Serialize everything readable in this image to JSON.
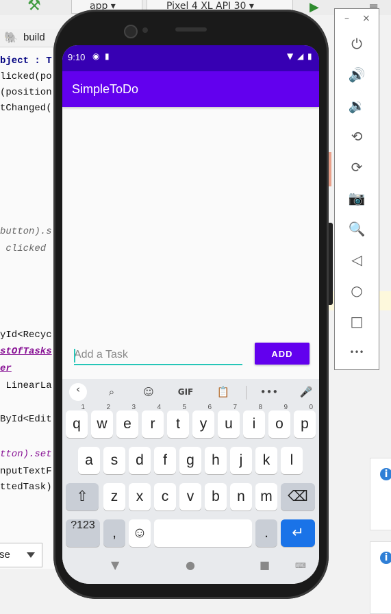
{
  "ide": {
    "config_label": "app",
    "device_label": "Pixel 4 XL API 30",
    "tab_label": "build",
    "select_label": "se",
    "code_lines": [
      {
        "text": "bject : T",
        "cls": "kw"
      },
      {
        "text": "licked(po",
        "cls": ""
      },
      {
        "text": "(position",
        "cls": ""
      },
      {
        "text": "tChanged(",
        "cls": ""
      },
      {
        "text": "button).s",
        "cls": "it"
      },
      {
        "text": " clicked ",
        "cls": "it"
      },
      {
        "text": "yId<Recyc",
        "cls": ""
      },
      {
        "text": "stOfTasks",
        "cls": "pu"
      },
      {
        "text": "er",
        "cls": "pu"
      },
      {
        "text": " LinearLa",
        "cls": ""
      },
      {
        "text": "ById<Edit",
        "cls": ""
      },
      {
        "text": "tton).set",
        "cls": "pu2"
      },
      {
        "text": "nputTextF",
        "cls": ""
      },
      {
        "text": "ttedTask)",
        "cls": ""
      }
    ]
  },
  "emulator_panel": {
    "minimize": "–",
    "close": "×",
    "buttons": [
      {
        "name": "power-icon",
        "glyph": "⏻"
      },
      {
        "name": "volume-up-icon",
        "glyph": "🔊"
      },
      {
        "name": "volume-down-icon",
        "glyph": "🔉"
      },
      {
        "name": "rotate-left-icon",
        "glyph": "⟲"
      },
      {
        "name": "rotate-right-icon",
        "glyph": "⟳"
      },
      {
        "name": "camera-icon",
        "glyph": "📷"
      },
      {
        "name": "zoom-icon",
        "glyph": "🔍"
      },
      {
        "name": "back-icon",
        "glyph": "◁"
      },
      {
        "name": "home-icon",
        "glyph": "○"
      },
      {
        "name": "overview-icon",
        "glyph": "□"
      },
      {
        "name": "more-icon",
        "glyph": "•••"
      }
    ]
  },
  "phone": {
    "status_time": "9:10",
    "app_title": "SimpleToDo",
    "input_placeholder": "Add a Task",
    "input_value": "",
    "add_button_label": "ADD",
    "colors": {
      "primary": "#6200ee",
      "primary_dark": "#3700b3",
      "accent": "#26c6b8"
    }
  },
  "keyboard": {
    "toolbar": [
      "search-icon",
      "sticker-icon",
      "GIF",
      "clipboard-icon",
      "more-icon",
      "mic-icon"
    ],
    "gif_label": "GIF",
    "row1": [
      {
        "k": "q",
        "h": "1"
      },
      {
        "k": "w",
        "h": "2"
      },
      {
        "k": "e",
        "h": "3"
      },
      {
        "k": "r",
        "h": "4"
      },
      {
        "k": "t",
        "h": "5"
      },
      {
        "k": "y",
        "h": "6"
      },
      {
        "k": "u",
        "h": "7"
      },
      {
        "k": "i",
        "h": "8"
      },
      {
        "k": "o",
        "h": "9"
      },
      {
        "k": "p",
        "h": "0"
      }
    ],
    "row2": [
      "a",
      "s",
      "d",
      "f",
      "g",
      "h",
      "j",
      "k",
      "l"
    ],
    "row3": [
      "z",
      "x",
      "c",
      "v",
      "b",
      "n",
      "m"
    ],
    "symbols_label": "?123",
    "comma_label": ",",
    "period_label": "."
  }
}
